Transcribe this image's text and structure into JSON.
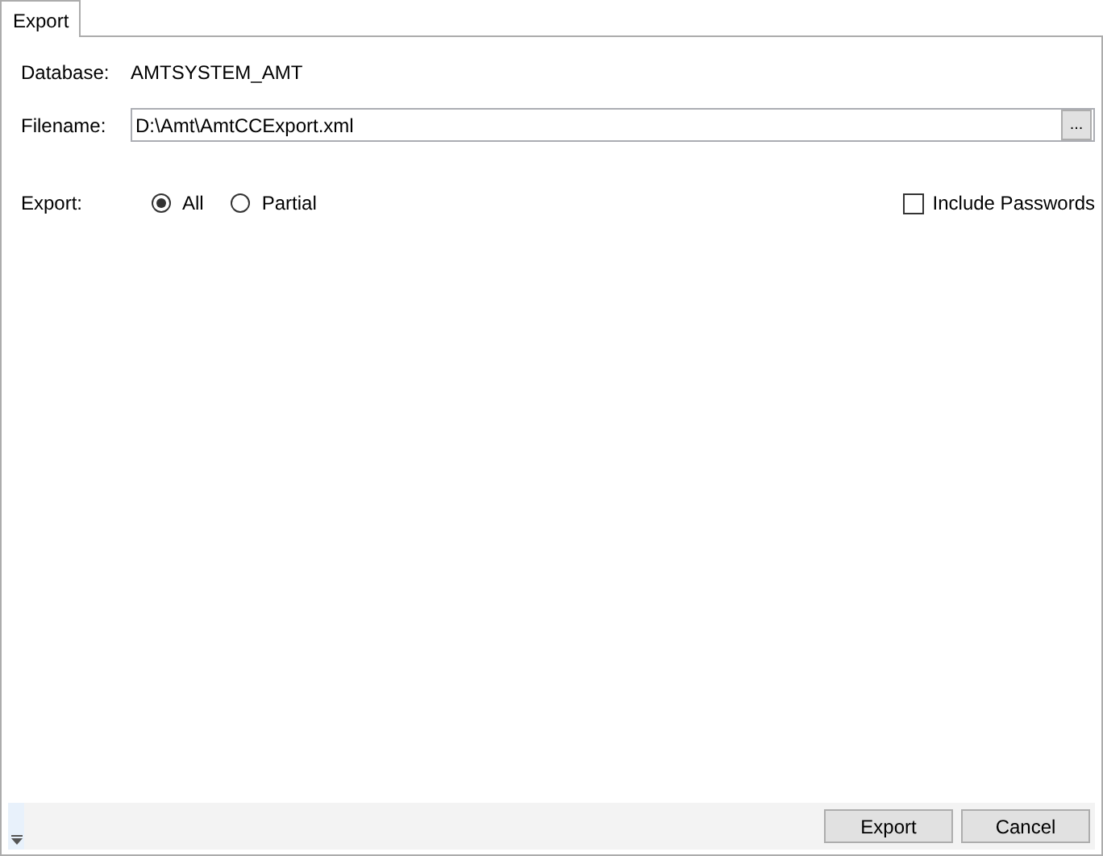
{
  "tabs": [
    {
      "label": "Export",
      "selected": true
    }
  ],
  "database": {
    "label": "Database:",
    "value": "AMTSYSTEM_AMT"
  },
  "filename": {
    "label": "Filename:",
    "value": "D:\\Amt\\AmtCCExport.xml",
    "browse_button": "..."
  },
  "export": {
    "label": "Export:",
    "options": [
      {
        "label": "All",
        "selected": true
      },
      {
        "label": "Partial",
        "selected": false
      }
    ]
  },
  "include_passwords": {
    "label": "Include Passwords",
    "checked": false
  },
  "buttons": [
    "Export",
    "Cancel"
  ]
}
